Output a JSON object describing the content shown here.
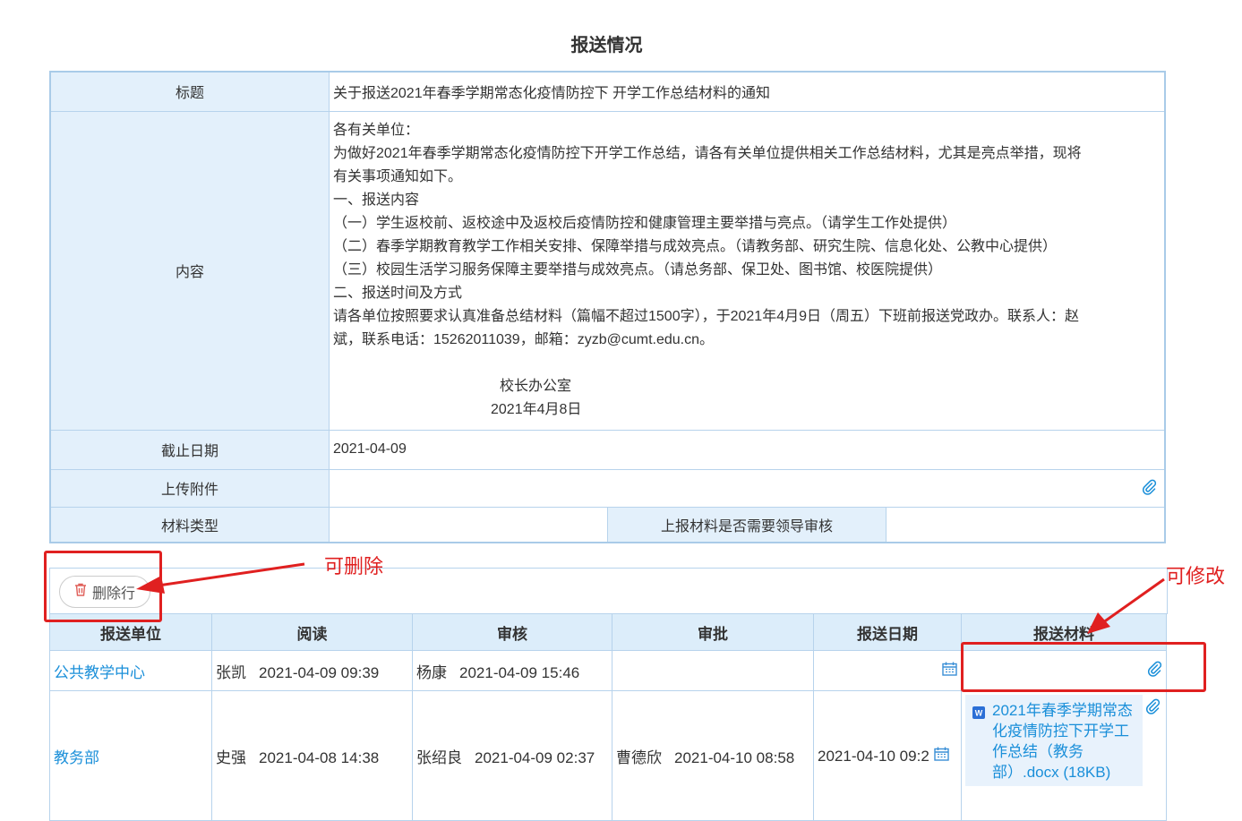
{
  "page": {
    "title": "报送情况"
  },
  "info": {
    "title_label": "标题",
    "title_value": "关于报送2021年春季学期常态化疫情防控下 开学工作总结材料的通知",
    "content_label": "内容",
    "content_lines": [
      "各有关单位：",
      "为做好2021年春季学期常态化疫情防控下开学工作总结，请各有关单位提供相关工作总结材料，尤其是亮点举措，现将",
      "有关事项通知如下。",
      "一、报送内容",
      "（一）学生返校前、返校途中及返校后疫情防控和健康管理主要举措与亮点。（请学生工作处提供）",
      "（二）春季学期教育教学工作相关安排、保障举措与成效亮点。（请教务部、研究生院、信息化处、公教中心提供）",
      "（三）校园生活学习服务保障主要举措与成效亮点。（请总务部、保卫处、图书馆、校医院提供）",
      "二、报送时间及方式",
      "请各单位按照要求认真准备总结材料（篇幅不超过1500字），于2021年4月9日（周五）下班前报送党政办。联系人：赵",
      "斌，联系电话：15262011039，邮箱：zyzb@cumt.edu.cn。"
    ],
    "signature": "校长办公室",
    "signature_date": "2021年4月8日",
    "deadline_label": "截止日期",
    "deadline_value": "2021-04-09",
    "attach_label": "上传附件",
    "type_label": "材料类型",
    "type_value": "",
    "review_label": "上报材料是否需要领导审核",
    "review_value": ""
  },
  "toolbar": {
    "delete_row": "删除行"
  },
  "grid": {
    "headers": [
      "报送单位",
      "阅读",
      "审核",
      "审批",
      "报送日期",
      "报送材料"
    ],
    "rows": [
      {
        "unit": "公共教学中心",
        "read_name": "张凯",
        "read_time": "2021-04-09 09:39",
        "audit_name": "杨康",
        "audit_time": "2021-04-09 15:46",
        "approve_name": "",
        "approve_time": "",
        "date": "",
        "file": ""
      },
      {
        "unit": "教务部",
        "read_name": "史强",
        "read_time": "2021-04-08 14:38",
        "audit_name": "张绍良",
        "audit_time": "2021-04-09 02:37",
        "approve_name": "曹德欣",
        "approve_time": "2021-04-10 08:58",
        "date": "2021-04-10 09:2",
        "file": "2021年春季学期常态化疫情防控下开学工作总结（教务部）.docx (18KB)"
      }
    ]
  },
  "annotations": {
    "deletable": "可删除",
    "editable": "可修改"
  },
  "colors": {
    "header_bg": "#dcedfa",
    "label_bg": "#e3f0fb",
    "link": "#1a8fd9",
    "annotation": "#e02020"
  }
}
